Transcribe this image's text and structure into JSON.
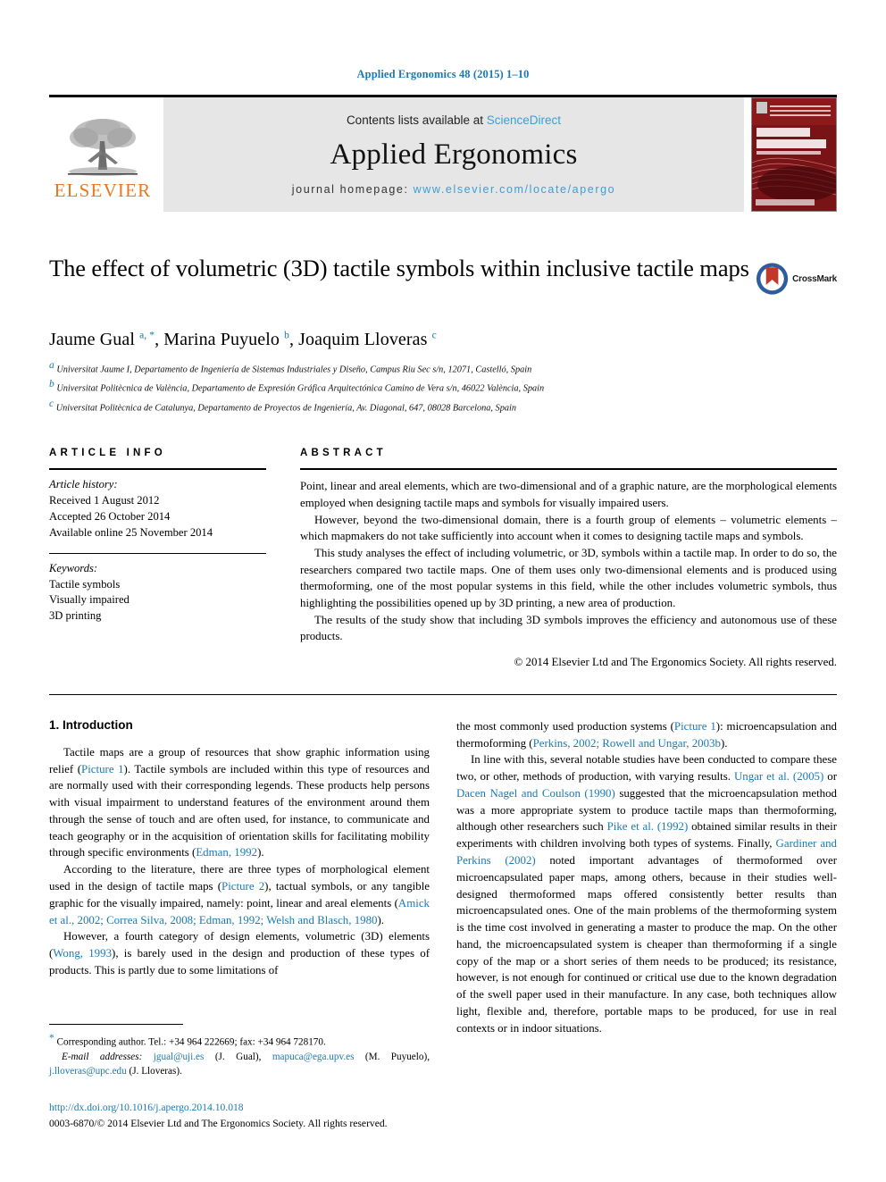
{
  "running_head": "Applied Ergonomics 48 (2015) 1–10",
  "masthead": {
    "contents_prefix": "Contents lists available at ",
    "sciencedirect": "ScienceDirect",
    "journal_name": "Applied Ergonomics",
    "homepage_prefix": "journal homepage: ",
    "homepage_url": "www.elsevier.com/locate/apergo",
    "publisher": "ELSEVIER",
    "cover_title_line1": "APPLIED",
    "cover_title_line2": "ERGONOMICS",
    "accent_blue": "#3a9fd8",
    "elsevier_orange": "#e87722",
    "cover_red": "#7d1113"
  },
  "article": {
    "title": "The effect of volumetric (3D) tactile symbols within inclusive tactile maps",
    "crossmark_label": "CrossMark",
    "authors_html": "Jaume Gual <sup>a, *</sup>, Marina Puyuelo <sup>b</sup>, Joaquim Lloveras <sup>c</sup>",
    "affiliations": [
      {
        "mark": "a",
        "text": "Universitat Jaume I, Departamento de Ingeniería de Sistemas Industriales y Diseño, Campus Riu Sec s/n, 12071, Castelló, Spain"
      },
      {
        "mark": "b",
        "text": "Universitat Politècnica de València, Departamento de Expresión Gráfica Arquitectónica Camino de Vera s/n, 46022 València, Spain"
      },
      {
        "mark": "c",
        "text": "Universitat Politècnica de Catalunya, Departamento de Proyectos de Ingeniería, Av. Diagonal, 647, 08028 Barcelona, Spain"
      }
    ]
  },
  "article_info": {
    "heading": "ARTICLE INFO",
    "history_label": "Article history:",
    "history": [
      "Received 1 August 2012",
      "Accepted 26 October 2014",
      "Available online 25 November 2014"
    ],
    "keywords_label": "Keywords:",
    "keywords": [
      "Tactile symbols",
      "Visually impaired",
      "3D printing"
    ]
  },
  "abstract": {
    "heading": "ABSTRACT",
    "paragraphs": [
      "Point, linear and areal elements, which are two-dimensional and of a graphic nature, are the morphological elements employed when designing tactile maps and symbols for visually impaired users.",
      "However, beyond the two-dimensional domain, there is a fourth group of elements – volumetric elements – which mapmakers do not take sufficiently into account when it comes to designing tactile maps and symbols.",
      "This study analyses the effect of including volumetric, or 3D, symbols within a tactile map. In order to do so, the researchers compared two tactile maps. One of them uses only two-dimensional elements and is produced using thermoforming, one of the most popular systems in this field, while the other includes volumetric symbols, thus highlighting the possibilities opened up by 3D printing, a new area of production.",
      "The results of the study show that including 3D symbols improves the efficiency and autonomous use of these products."
    ],
    "copyright": "© 2014 Elsevier Ltd and The Ergonomics Society. All rights reserved."
  },
  "introduction": {
    "section_number_title": "1.  Introduction",
    "left_column_html": "<p style=\"text-indent:16px\">Tactile maps are a group of resources that show graphic information using relief (<span class=\"ref\">Picture 1</span>). Tactile symbols are included within this type of resources and are normally used with their corresponding legends. These products help persons with visual impairment to understand features of the environment around them through the sense of touch and are often used, for instance, to communicate and teach geography or in the acquisition of orientation skills for facilitating mobility through specific environments (<span class=\"ref\">Edman, 1992</span>).</p><p style=\"text-indent:16px\">According to the literature, there are three types of morphological element used in the design of tactile maps (<span class=\"ref\">Picture 2</span>), tactual symbols, or any tangible graphic for the visually impaired, namely: point, linear and areal elements (<span class=\"ref\">Amick et al., 2002; Correa Silva, 2008; Edman, 1992; Welsh and Blasch, 1980</span>).</p><p style=\"text-indent:16px\">However, a fourth category of design elements, volumetric (3D) elements (<span class=\"ref\">Wong, 1993</span>), is barely used in the design and production of these types of products. This is partly due to some limitations of</p>",
    "right_column_html": "<p style=\"text-indent:0\">the most commonly used production systems (<span class=\"ref\">Picture 1</span>): microencapsulation and thermoforming (<span class=\"ref\">Perkins, 2002; Rowell and Ungar, 2003b</span>).</p><p style=\"text-indent:16px\">In line with this, several notable studies have been conducted to compare these two, or other, methods of production, with varying results. <span class=\"ref\">Ungar et al. (2005)</span> or <span class=\"ref\">Dacen Nagel and Coulson (1990)</span> suggested that the microencapsulation method was a more appropriate system to produce tactile maps than thermoforming, although other researchers such <span class=\"ref\">Pike et al. (1992)</span> obtained similar results in their experiments with children involving both types of systems. Finally, <span class=\"ref\">Gardiner and Perkins (2002)</span> noted important advantages of thermoformed over microencapsulated paper maps, among others, because in their studies well-designed thermoformed maps offered consistently better results than microencapsulated ones. One of the main problems of the thermoforming system is the time cost involved in generating a master to produce the map. On the other hand, the microencapsulated system is cheaper than thermoforming if a single copy of the map or a short series of them needs to be produced; its resistance, however, is not enough for continued or critical use due to the known degradation of the swell paper used in their manufacture. In any case, both techniques allow light, flexible and, therefore, portable maps to be produced, for use in real contexts or in indoor situations.</p>"
  },
  "footnotes": {
    "corresponding_author": "Corresponding author. Tel.: +34 964 222669; fax: +34 964 728170.",
    "email_label": "E-mail addresses:",
    "emails_html": "<span class=\"doi-link\">jgual@uji.es</span> (J. Gual), <span class=\"doi-link\">mapuca@ega.upv.es</span> (M. Puyuelo), <span class=\"doi-link\">j.lloveras@upc.edu</span> (J. Lloveras).",
    "doi": "http://dx.doi.org/10.1016/j.apergo.2014.10.018",
    "issn_copyright": "0003-6870/© 2014 Elsevier Ltd and The Ergonomics Society. All rights reserved."
  }
}
